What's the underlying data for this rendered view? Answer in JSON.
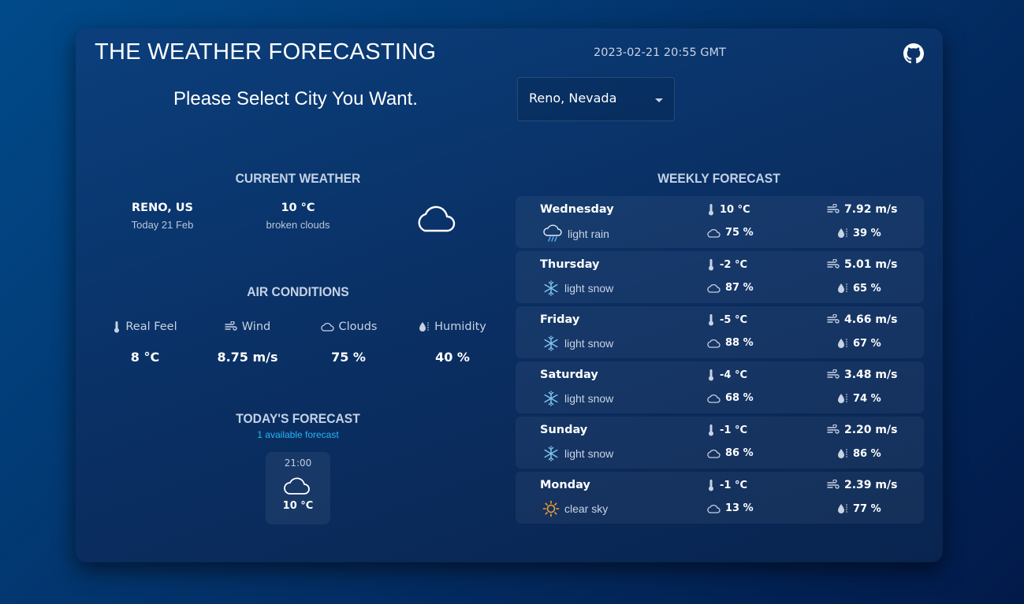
{
  "header": {
    "title": "THE WEATHER FORECASTING",
    "datetime": "2023-02-21 20:55 GMT",
    "github_icon": "github-icon"
  },
  "search": {
    "prompt": "Please Select City You Want.",
    "selected_city": "Reno, Nevada"
  },
  "current": {
    "section_title": "CURRENT WEATHER",
    "city": "RENO, US",
    "date": "Today 21 Feb",
    "temperature": "10 °C",
    "description": "broken clouds",
    "icon": "cloud-icon"
  },
  "air": {
    "section_title": "AIR CONDITIONS",
    "items": [
      {
        "label": "Real Feel",
        "value": "8 °C",
        "icon": "thermometer-icon"
      },
      {
        "label": "Wind",
        "value": "8.75 m/s",
        "icon": "wind-icon"
      },
      {
        "label": "Clouds",
        "value": "75 %",
        "icon": "cloud-icon"
      },
      {
        "label": "Humidity",
        "value": "40 %",
        "icon": "humidity-icon"
      }
    ]
  },
  "today": {
    "section_title": "TODAY'S FORECAST",
    "subtitle": "1 available forecast",
    "hours": [
      {
        "time": "21:00",
        "temperature": "10 °C",
        "icon": "cloud-icon"
      }
    ]
  },
  "weekly": {
    "section_title": "WEEKLY FORECAST",
    "days": [
      {
        "day": "Wednesday",
        "description": "light rain",
        "icon": "rain-cloud-icon",
        "temperature": "10 °C",
        "wind": "7.92 m/s",
        "clouds": "75 %",
        "humidity": "39 %"
      },
      {
        "day": "Thursday",
        "description": "light snow",
        "icon": "snowflake-icon",
        "temperature": "-2 °C",
        "wind": "5.01 m/s",
        "clouds": "87 %",
        "humidity": "65 %"
      },
      {
        "day": "Friday",
        "description": "light snow",
        "icon": "snowflake-icon",
        "temperature": "-5 °C",
        "wind": "4.66 m/s",
        "clouds": "88 %",
        "humidity": "67 %"
      },
      {
        "day": "Saturday",
        "description": "light snow",
        "icon": "snowflake-icon",
        "temperature": "-4 °C",
        "wind": "3.48 m/s",
        "clouds": "68 %",
        "humidity": "74 %"
      },
      {
        "day": "Sunday",
        "description": "light snow",
        "icon": "snowflake-icon",
        "temperature": "-1 °C",
        "wind": "2.20 m/s",
        "clouds": "86 %",
        "humidity": "86 %"
      },
      {
        "day": "Monday",
        "description": "clear sky",
        "icon": "sun-icon",
        "temperature": "-1 °C",
        "wind": "2.39 m/s",
        "clouds": "13 %",
        "humidity": "77 %"
      }
    ]
  },
  "colors": {
    "background": "#03336b",
    "card": "#0a2f63",
    "accent_blue": "#2ab4f5",
    "sun": "#f0a030",
    "snow": "#7fc4f0"
  }
}
